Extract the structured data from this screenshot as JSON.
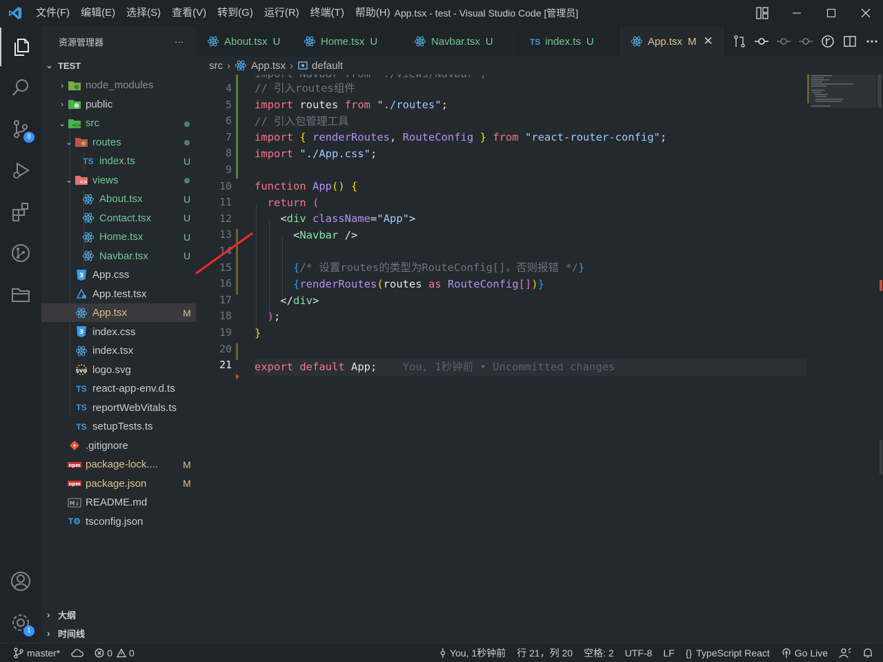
{
  "window": {
    "title": "App.tsx - test - Visual Studio Code [管理员]",
    "menu": [
      "文件(F)",
      "编辑(E)",
      "选择(S)",
      "查看(V)",
      "转到(G)",
      "运行(R)",
      "终端(T)",
      "帮助(H)"
    ]
  },
  "activity": {
    "source_control_badge": "8",
    "settings_badge": "1"
  },
  "sidebar": {
    "title": "资源管理器",
    "more": "···",
    "root": "TEST",
    "tree": [
      {
        "name": "node_modules",
        "icon": "node-folder-icon",
        "status": "",
        "dim": true
      },
      {
        "name": "public",
        "icon": "public-folder-icon",
        "status": ""
      },
      {
        "name": "src",
        "icon": "src-folder-icon",
        "status": "dot",
        "status_color": "#73c991",
        "color": "#73c991"
      },
      {
        "name": "routes",
        "icon": "routes-folder-icon",
        "status": "dot",
        "status_color": "#73c991",
        "color": "#73c991"
      },
      {
        "name": "index.ts",
        "icon": "typescript-icon",
        "status": "U",
        "color": "#73c991"
      },
      {
        "name": "views",
        "icon": "views-folder-icon",
        "status": "dot",
        "status_color": "#73c991",
        "color": "#73c991"
      },
      {
        "name": "About.tsx",
        "icon": "react-icon",
        "status": "U",
        "color": "#73c991"
      },
      {
        "name": "Contact.tsx",
        "icon": "react-icon",
        "status": "U",
        "color": "#73c991"
      },
      {
        "name": "Home.tsx",
        "icon": "react-icon",
        "status": "U",
        "color": "#73c991"
      },
      {
        "name": "Navbar.tsx",
        "icon": "react-icon",
        "status": "U",
        "color": "#73c991"
      },
      {
        "name": "App.css",
        "icon": "css-icon",
        "status": ""
      },
      {
        "name": "App.test.tsx",
        "icon": "test-icon",
        "status": ""
      },
      {
        "name": "App.tsx",
        "icon": "react-icon",
        "status": "M",
        "color": "#e2c08d"
      },
      {
        "name": "index.css",
        "icon": "css-icon",
        "status": ""
      },
      {
        "name": "index.tsx",
        "icon": "react-icon",
        "status": ""
      },
      {
        "name": "logo.svg",
        "icon": "svg-icon",
        "status": ""
      },
      {
        "name": "react-app-env.d.ts",
        "icon": "typescript-icon",
        "status": ""
      },
      {
        "name": "reportWebVitals.ts",
        "icon": "typescript-icon",
        "status": ""
      },
      {
        "name": "setupTests.ts",
        "icon": "typescript-icon",
        "status": ""
      },
      {
        "name": ".gitignore",
        "icon": "git-icon",
        "status": ""
      },
      {
        "name": "package-lock....",
        "icon": "npm-icon",
        "status": "M",
        "color": "#e2c08d"
      },
      {
        "name": "package.json",
        "icon": "npm-icon",
        "status": "M",
        "color": "#e2c08d"
      },
      {
        "name": "README.md",
        "icon": "markdown-icon",
        "status": ""
      },
      {
        "name": "tsconfig.json",
        "icon": "tsconfig-icon",
        "status": ""
      }
    ],
    "outline": "大纲",
    "timeline": "时间线"
  },
  "tabs": [
    {
      "name": "About.tsx",
      "state": "U",
      "icon": "react-icon"
    },
    {
      "name": "Home.tsx",
      "state": "U",
      "icon": "react-icon"
    },
    {
      "name": "Navbar.tsx",
      "state": "U",
      "icon": "react-icon"
    },
    {
      "name": "index.ts",
      "state": "U",
      "icon": "typescript-icon"
    },
    {
      "name": "App.tsx",
      "state": "M",
      "icon": "react-icon",
      "active": true
    }
  ],
  "breadcrumb": {
    "folder": "src",
    "file": "App.tsx",
    "symbol": "default"
  },
  "editor": {
    "partial_top_line": "import Navbar from \"./views/Navbar\";",
    "line_numbers": [
      "4",
      "5",
      "6",
      "7",
      "8",
      "9",
      "10",
      "11",
      "12",
      "13",
      "14",
      "15",
      "16",
      "17",
      "18",
      "19",
      "20",
      "21"
    ],
    "current_line": "21",
    "blame": "You, 1秒钟前 • Uncommitted changes"
  },
  "status": {
    "branch": "master*",
    "errors": "0",
    "warnings": "0",
    "author": "You, 1秒钟前",
    "position": "行 21，列 20",
    "spaces": "空格: 2",
    "encoding": "UTF-8",
    "eol": "LF",
    "language": "TypeScript React",
    "golive": "Go Live"
  },
  "colors": {
    "accent": "#3794ff",
    "untracked": "#73c991",
    "modified": "#e2c08d",
    "arrow": "#ee2a2a"
  }
}
